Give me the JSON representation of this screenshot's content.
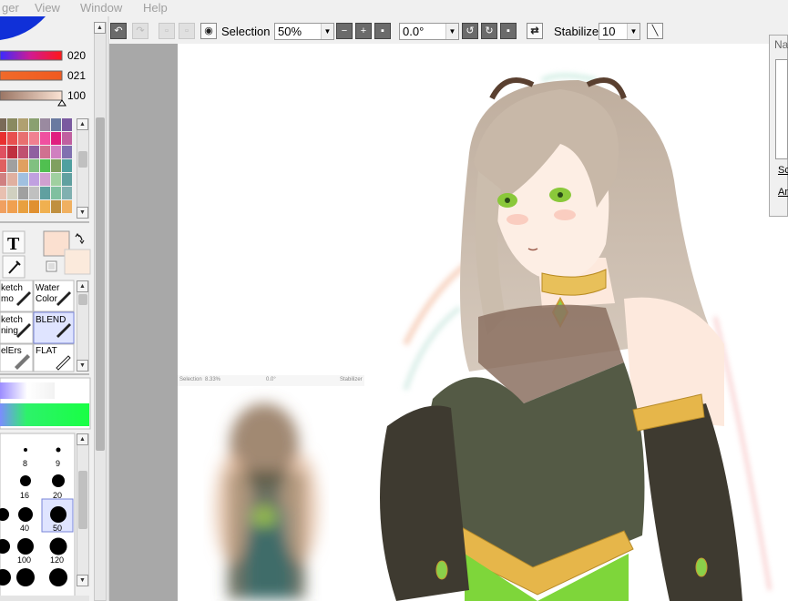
{
  "menu": {
    "items": [
      "ger",
      "View",
      "Window",
      "Help"
    ]
  },
  "colors": {
    "slider_values": [
      "020",
      "021",
      "100"
    ],
    "selected_fg": "#fbe0d0",
    "selected_bg": "#fbeadc"
  },
  "tools": [
    {
      "line1": "ketch",
      "line2": "mo"
    },
    {
      "line1": "Water",
      "line2": "Color"
    },
    {
      "line1": "ketch",
      "line2": "ning"
    },
    {
      "line1": "BLEND",
      "line2": ""
    },
    {
      "line1": "elErs",
      "line2": ""
    },
    {
      "line1": "FLAT",
      "line2": ""
    }
  ],
  "brush_sizes": [
    "8",
    "9",
    "16",
    "20",
    "40",
    "50",
    "100",
    "120"
  ],
  "toolbar": {
    "selection_label": "Selection",
    "zoom_value": "50%",
    "rotation_value": "0.0°",
    "stabilizer_label": "Stabilizer",
    "stabilizer_value": "10"
  },
  "ghost_toolbar": {
    "selection": "Selection",
    "zoom": "8.33%",
    "rotation": "0.0°",
    "stabilizer": "Stabilizer"
  },
  "nav_panel": {
    "title": "Na",
    "item1": "Sc",
    "item2": "An"
  }
}
